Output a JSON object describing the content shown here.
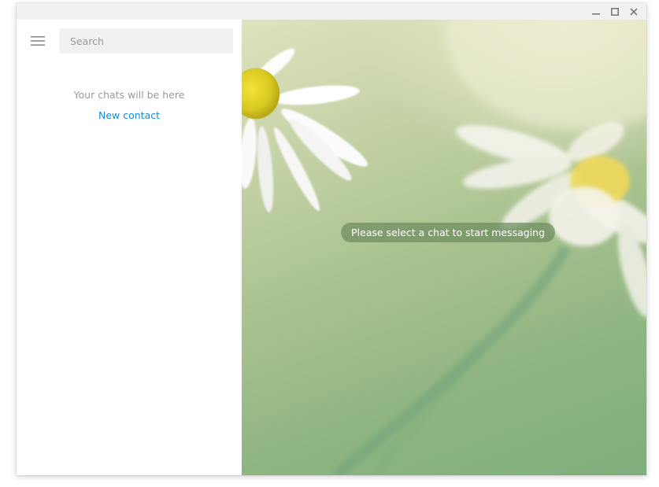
{
  "window": {
    "controls": {
      "minimize": "minimize",
      "maximize": "maximize",
      "close": "close"
    }
  },
  "sidebar": {
    "menu_icon": "hamburger-menu-icon",
    "search": {
      "placeholder": "Search",
      "value": ""
    },
    "empty_text": "Your chats will be here",
    "new_contact_label": "New contact"
  },
  "chat": {
    "placeholder_message": "Please select a chat to start messaging",
    "background": "chamomile-flowers-wallpaper"
  },
  "colors": {
    "link": "#168acd",
    "muted_text": "#999999",
    "search_bg": "#f1f1f1",
    "titlebar_bg": "#f1f1f1",
    "badge_bg": "#6e8c5f"
  }
}
